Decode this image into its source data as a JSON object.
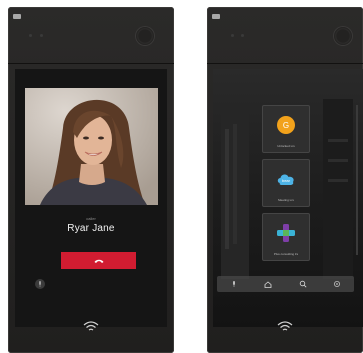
{
  "left_device": {
    "caller_label": "caller",
    "caller_name": "Ryar Jane",
    "end_call_color": "#d11c31"
  },
  "right_device": {
    "apps": [
      {
        "label": "Unlocked Lrs",
        "icon": "circle-app-icon",
        "color": "#f2a21b",
        "letter": "G"
      },
      {
        "label": "Meeting Lrs",
        "icon": "cloud-app-icon",
        "color": "#4db3e6",
        "letter": "bear"
      },
      {
        "label": "Plus consulting lrs",
        "icon": "cross-app-icon",
        "color": "#7e3ea8",
        "letter": ""
      }
    ],
    "dock": [
      "mic-icon",
      "home-icon",
      "search-icon",
      "settings-icon"
    ]
  }
}
